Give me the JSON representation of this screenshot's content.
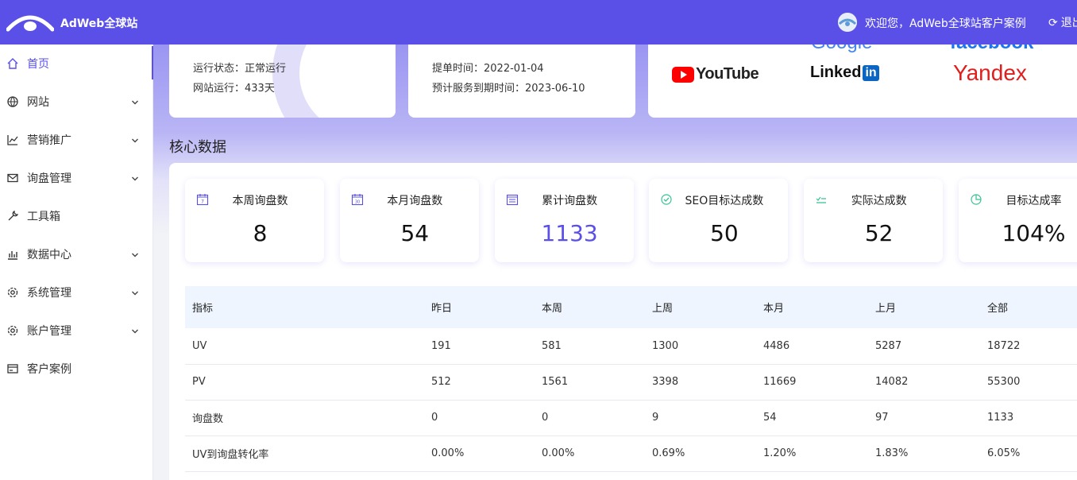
{
  "header": {
    "brand": "AdWeb全球站",
    "welcome": "欢迎您，AdWeb全球站客户案例",
    "logout": "退出"
  },
  "sidebar": {
    "items": [
      {
        "label": "首页",
        "icon": "home-icon",
        "active": true,
        "expandable": false
      },
      {
        "label": "网站",
        "icon": "globe-icon",
        "active": false,
        "expandable": true
      },
      {
        "label": "营销推广",
        "icon": "line-chart-icon",
        "active": false,
        "expandable": true
      },
      {
        "label": "询盘管理",
        "icon": "mail-icon",
        "active": false,
        "expandable": true
      },
      {
        "label": "工具箱",
        "icon": "wrench-icon",
        "active": false,
        "expandable": false
      },
      {
        "label": "数据中心",
        "icon": "bar-chart-icon",
        "active": false,
        "expandable": true
      },
      {
        "label": "系统管理",
        "icon": "gear-icon",
        "active": false,
        "expandable": true
      },
      {
        "label": "账户管理",
        "icon": "gear-icon",
        "active": false,
        "expandable": true
      },
      {
        "label": "客户案例",
        "icon": "card-icon",
        "active": false,
        "expandable": false
      }
    ]
  },
  "site_status": {
    "running_label": "运行状态：正常运行",
    "days_label": "网站运行：433天"
  },
  "service": {
    "submit_time": "提单时间：2022-01-04",
    "expire_time": "预计服务到期时间：2023-06-10"
  },
  "platforms": {
    "youtube": "YouTube",
    "linkedin_a": "Linked",
    "linkedin_b": "in",
    "yandex": "Yandex",
    "google_partial": "Google",
    "facebook_partial": "facebook"
  },
  "core": {
    "title": "核心数据",
    "stats": [
      {
        "label": "本周询盘数",
        "value": "8",
        "icon": "calendar-week-icon"
      },
      {
        "label": "本月询盘数",
        "value": "54",
        "icon": "calendar-month-icon"
      },
      {
        "label": "累计询盘数",
        "value": "1133",
        "icon": "calendar-total-icon"
      },
      {
        "label": "SEO目标达成数",
        "value": "50",
        "icon": "check-circle-icon"
      },
      {
        "label": "实际达成数",
        "value": "52",
        "icon": "check-list-icon"
      },
      {
        "label": "目标达成率",
        "value": "104%",
        "icon": "pie-icon"
      }
    ]
  },
  "table": {
    "headers": [
      "指标",
      "昨日",
      "本周",
      "上周",
      "本月",
      "上月",
      "全部"
    ],
    "rows": [
      [
        "UV",
        "191",
        "581",
        "1300",
        "4486",
        "5287",
        "18722"
      ],
      [
        "PV",
        "512",
        "1561",
        "3398",
        "11669",
        "14082",
        "55300"
      ],
      [
        "询盘数",
        "0",
        "0",
        "9",
        "54",
        "97",
        "1133"
      ],
      [
        "UV到询盘转化率",
        "0.00%",
        "0.00%",
        "0.69%",
        "1.20%",
        "1.83%",
        "6.05%"
      ]
    ]
  },
  "colors": {
    "accent": "#5a50e8",
    "youtube_red": "#ff0000",
    "linkedin_blue": "#0a66c2",
    "yandex_red": "#e01e1e",
    "facebook_blue": "#1877f2"
  }
}
